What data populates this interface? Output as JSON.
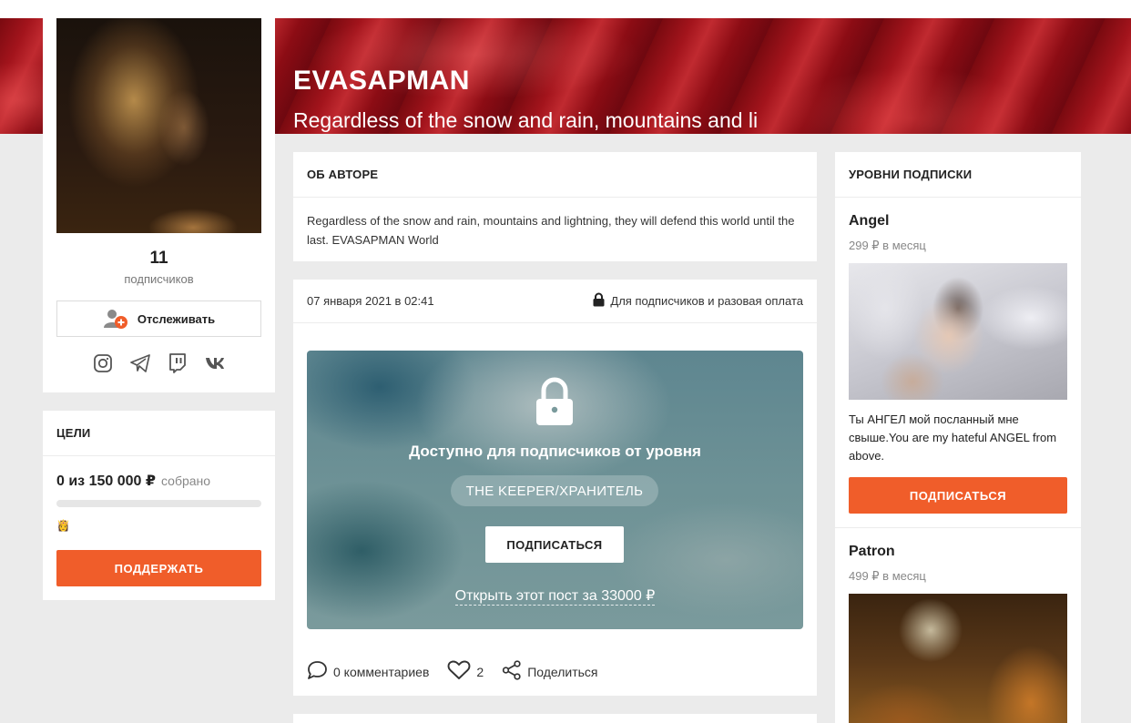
{
  "banner": {
    "title": "EVASAPMAN",
    "subtitle": "Regardless of the snow and rain, mountains and li"
  },
  "profile": {
    "subscribers_count": "11",
    "subscribers_label": "подписчиков",
    "follow_label": "Отслеживать",
    "socials": [
      "instagram-icon",
      "telegram-icon",
      "twitch-icon",
      "vk-icon"
    ]
  },
  "goals": {
    "heading": "ЦЕЛИ",
    "amount": "0 из 150 000 ₽",
    "amount_label": "собрано",
    "progress": 0,
    "emoji": "👸",
    "support_label": "ПОДДЕРЖАТЬ"
  },
  "about": {
    "heading": "ОБ АВТОРЕ",
    "text": "Regardless of the snow and rain, mountains and lightning, they will defend this world until the last. EVASAPMAN World"
  },
  "post": {
    "date": "07 января 2021 в 02:41",
    "access": "Для подписчиков и разовая оплата",
    "locked_title": "Доступно для подписчиков от уровня",
    "tier": "THE KEEPER/ХРАНИТЕЛЬ",
    "subscribe_label": "ПОДПИСАТЬСЯ",
    "open_label": "Открыть этот пост за 33000 ₽",
    "comments": "0 комментариев",
    "likes": "2",
    "share": "Поделиться"
  },
  "tiers": {
    "heading": "УРОВНИ ПОДПИСКИ",
    "items": [
      {
        "name": "Angel",
        "price": "299 ₽ в месяц",
        "desc": "Ты АНГЕЛ мой посланный мне свыше.You are my hateful ANGEL from above.",
        "button": "ПОДПИСАТЬСЯ"
      },
      {
        "name": "Patron",
        "price": "499 ₽ в месяц"
      }
    ]
  },
  "colors": {
    "accent": "#f05d2a",
    "banner": "#a3141c",
    "page_bg": "#ebebeb"
  }
}
